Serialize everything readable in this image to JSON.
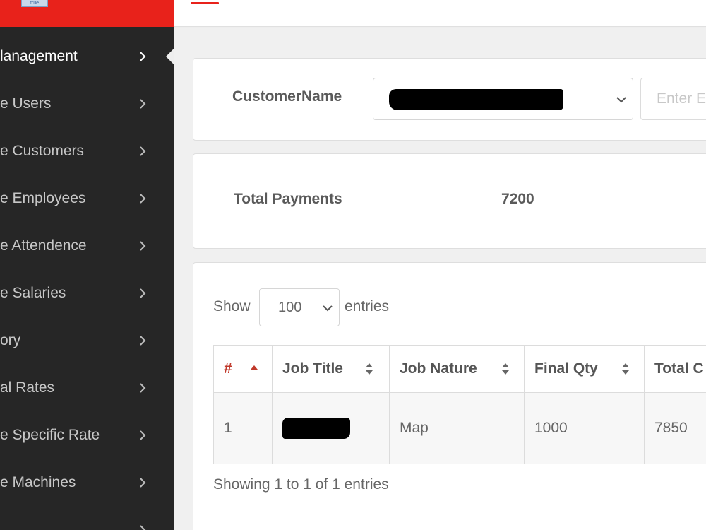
{
  "logo": {
    "text": "true"
  },
  "sidebar": {
    "items": [
      {
        "label": "lanagement",
        "active": true
      },
      {
        "label": "e Users"
      },
      {
        "label": "e Customers"
      },
      {
        "label": "e Employees"
      },
      {
        "label": "e Attendence"
      },
      {
        "label": "e Salaries"
      },
      {
        "label": "ory"
      },
      {
        "label": "al Rates"
      },
      {
        "label": "e Specific Rate"
      },
      {
        "label": "e Machines"
      },
      {
        "label": ""
      }
    ]
  },
  "filter": {
    "customer_label": "CustomerName",
    "customer_value": "",
    "input_placeholder": "Enter E"
  },
  "totals": {
    "label": "Total Payments",
    "value": "7200"
  },
  "table": {
    "show_label": "Show",
    "entries_label": "entries",
    "page_length": "100",
    "columns": [
      "#",
      "Job Title",
      "Job Nature",
      "Final Qty",
      "Total C"
    ],
    "rows": [
      {
        "num": "1",
        "job_title": "",
        "job_nature": "Map",
        "final_qty": "1000",
        "total": "7850"
      }
    ],
    "info": "Showing 1 to 1 of 1 entries"
  },
  "colors": {
    "brand": "#e8221b",
    "sidebar_bg": "#262626",
    "sort_active": "#c0392b"
  },
  "icons": {
    "chevron": "chevron-right-icon",
    "select": "chevron-down-icon",
    "sort": "sort-both-icon",
    "sort_asc": "sort-asc-icon"
  }
}
